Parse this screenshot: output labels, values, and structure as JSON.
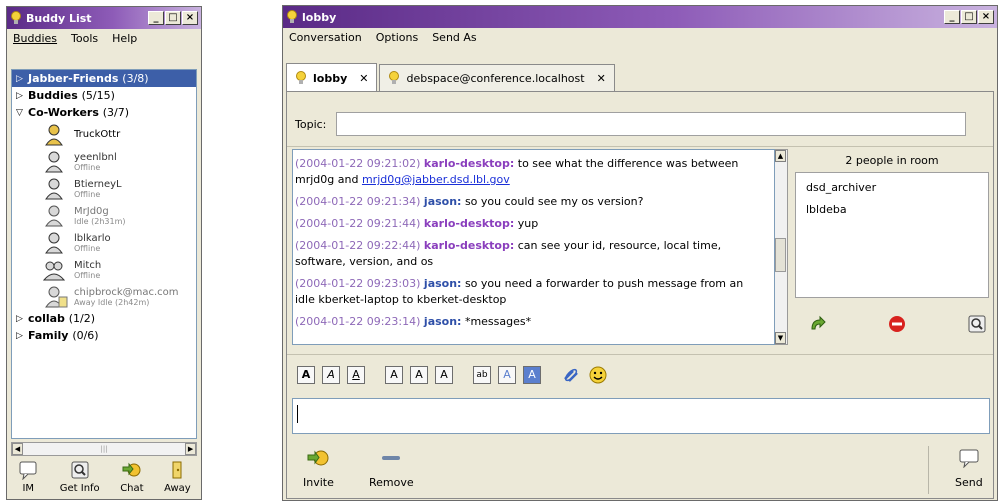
{
  "buddy_window": {
    "title": "Buddy List",
    "menu": [
      "Buddies",
      "Tools",
      "Help"
    ],
    "groups": [
      {
        "name": "Jabber-Friends",
        "count": "(3/8)",
        "expanded": false,
        "selected": true
      },
      {
        "name": "Buddies",
        "count": "(5/15)",
        "expanded": false,
        "selected": false
      },
      {
        "name": "Co-Workers",
        "count": "(3/7)",
        "expanded": true,
        "selected": false
      }
    ],
    "buddies": [
      {
        "name": "TruckOttr",
        "status": "",
        "icon": "online-user-icon"
      },
      {
        "name": "yeenlbnl",
        "status": "Offline",
        "icon": "offline-user-icon"
      },
      {
        "name": "BtierneyL",
        "status": "Offline",
        "icon": "offline-user-icon"
      },
      {
        "name": "MrJd0g",
        "status": "Idle (2h31m)",
        "icon": "idle-user-icon"
      },
      {
        "name": "lblkarlo",
        "status": "Offline",
        "icon": "offline-user-icon"
      },
      {
        "name": "Mitch",
        "status": "Offline",
        "icon": "group-user-icon"
      },
      {
        "name": "chipbrock@mac.com",
        "status": "Away Idle (2h42m)",
        "icon": "away-user-icon"
      }
    ],
    "groups_after": [
      {
        "name": "collab",
        "count": "(1/2)"
      },
      {
        "name": "Family",
        "count": "(0/6)"
      }
    ],
    "bottom_buttons": [
      {
        "label": "IM",
        "icon": "im-icon"
      },
      {
        "label": "Get Info",
        "icon": "get-info-icon"
      },
      {
        "label": "Chat",
        "icon": "chat-icon"
      },
      {
        "label": "Away",
        "icon": "away-icon"
      }
    ]
  },
  "lobby_window": {
    "title": "lobby",
    "menu": [
      "Conversation",
      "Options",
      "Send As"
    ],
    "tabs": [
      {
        "label": "lobby",
        "active": true
      },
      {
        "label": "debspace@conference.localhost",
        "active": false
      }
    ],
    "topic_label": "Topic:",
    "topic_value": "",
    "messages": [
      {
        "ts": "(2004-01-22 09:21:02)",
        "who": "karlo-desktop:",
        "text": " to see what the difference was between mrjd0g and ",
        "link": "mrjd0g@jabber.dsd.lbl.gov"
      },
      {
        "ts": "(2004-01-22 09:21:34)",
        "who": "jason:",
        "text": " so you could see my os version?"
      },
      {
        "ts": "(2004-01-22 09:21:44)",
        "who": "karlo-desktop:",
        "text": " yup"
      },
      {
        "ts": "(2004-01-22 09:22:44)",
        "who": "karlo-desktop:",
        "text": " can see your id, resource, local time, software, version, and os"
      },
      {
        "ts": "(2004-01-22 09:23:03)",
        "who": "jason:",
        "text": " so you need a forwarder to push message from an idle kberket-laptop to kberket-desktop"
      },
      {
        "ts": "(2004-01-22 09:23:14)",
        "who": "jason:",
        "text": " *messages*"
      }
    ],
    "room_header": "2 people in room",
    "room_members": [
      "dsd_archiver",
      "lbldeba"
    ],
    "room_icons": [
      "rejoin-arrow-icon",
      "block-user-icon",
      "user-info-icon"
    ],
    "format_buttons": [
      {
        "label": "A",
        "name": "bold-button",
        "style": "b"
      },
      {
        "label": "A",
        "name": "italic-button",
        "style": "i"
      },
      {
        "label": "A",
        "name": "underline-button",
        "style": "u"
      },
      {
        "label": "A",
        "name": "text-bigger-button",
        "style": ""
      },
      {
        "label": "A",
        "name": "text-normal-button",
        "style": ""
      },
      {
        "label": "A",
        "name": "text-smaller-button",
        "style": ""
      },
      {
        "label": "ab",
        "name": "font-face-button",
        "style": ""
      },
      {
        "label": "A",
        "name": "foreground-color-button",
        "style": ""
      },
      {
        "label": "A",
        "name": "background-color-button",
        "style": "hl"
      }
    ],
    "action_buttons": [
      {
        "label": "Invite",
        "icon": "invite-icon"
      },
      {
        "label": "Remove",
        "icon": "remove-icon"
      },
      {
        "label": "Send",
        "icon": "send-icon"
      }
    ],
    "colors": {
      "timestamp": "#8e69b8",
      "karlo": "#8a3ebd",
      "jason": "#2e4fa8",
      "selected_group": "#3d5fa8",
      "titlebar": "#5a2a86"
    }
  }
}
